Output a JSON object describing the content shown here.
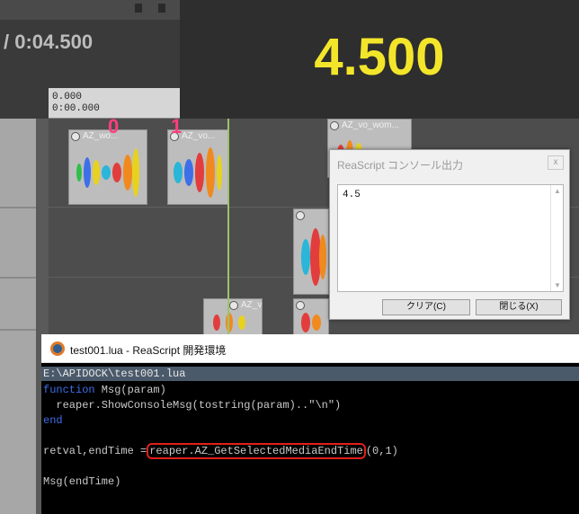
{
  "transport": {
    "time_display": "/ 0:04.500"
  },
  "overlay": {
    "big_value": "4.500",
    "color": "#f3e62a"
  },
  "ruler": {
    "line1": "0.000",
    "line2": "0:00.000"
  },
  "markers": [
    {
      "label": "0"
    },
    {
      "label": "1"
    }
  ],
  "items": [
    {
      "title": "AZ_wo..."
    },
    {
      "title": "AZ_vo..."
    },
    {
      "title": "AZ_vo_wom..."
    },
    {
      "title": ""
    },
    {
      "title": "AZ_vo..."
    },
    {
      "title": ""
    }
  ],
  "console": {
    "title": "ReaScript コンソール出力",
    "close": "x",
    "output": "4.5",
    "clear_button": "クリア(C)",
    "close_button": "閉じる(X)"
  },
  "ide": {
    "title": "test001.lua - ReaScript 開発環境",
    "path": "E:\\APIDOCK\\test001.lua",
    "code": {
      "l1_kw": "function",
      "l1_rest": " Msg(param)",
      "l2": "  reaper.ShowConsoleMsg(tostring(param)..\"\\n\")",
      "l3_kw": "end",
      "l5_a": "retval,endTime =",
      "l5_hl": "reaper.AZ_GetSelectedMediaEndTime",
      "l5_b": "(0,1)",
      "l7": "Msg(endTime)"
    }
  },
  "colors": {
    "keyword": "#3f6fe8",
    "highlight_box": "#e0201a",
    "marker": "#ff3d7f"
  }
}
